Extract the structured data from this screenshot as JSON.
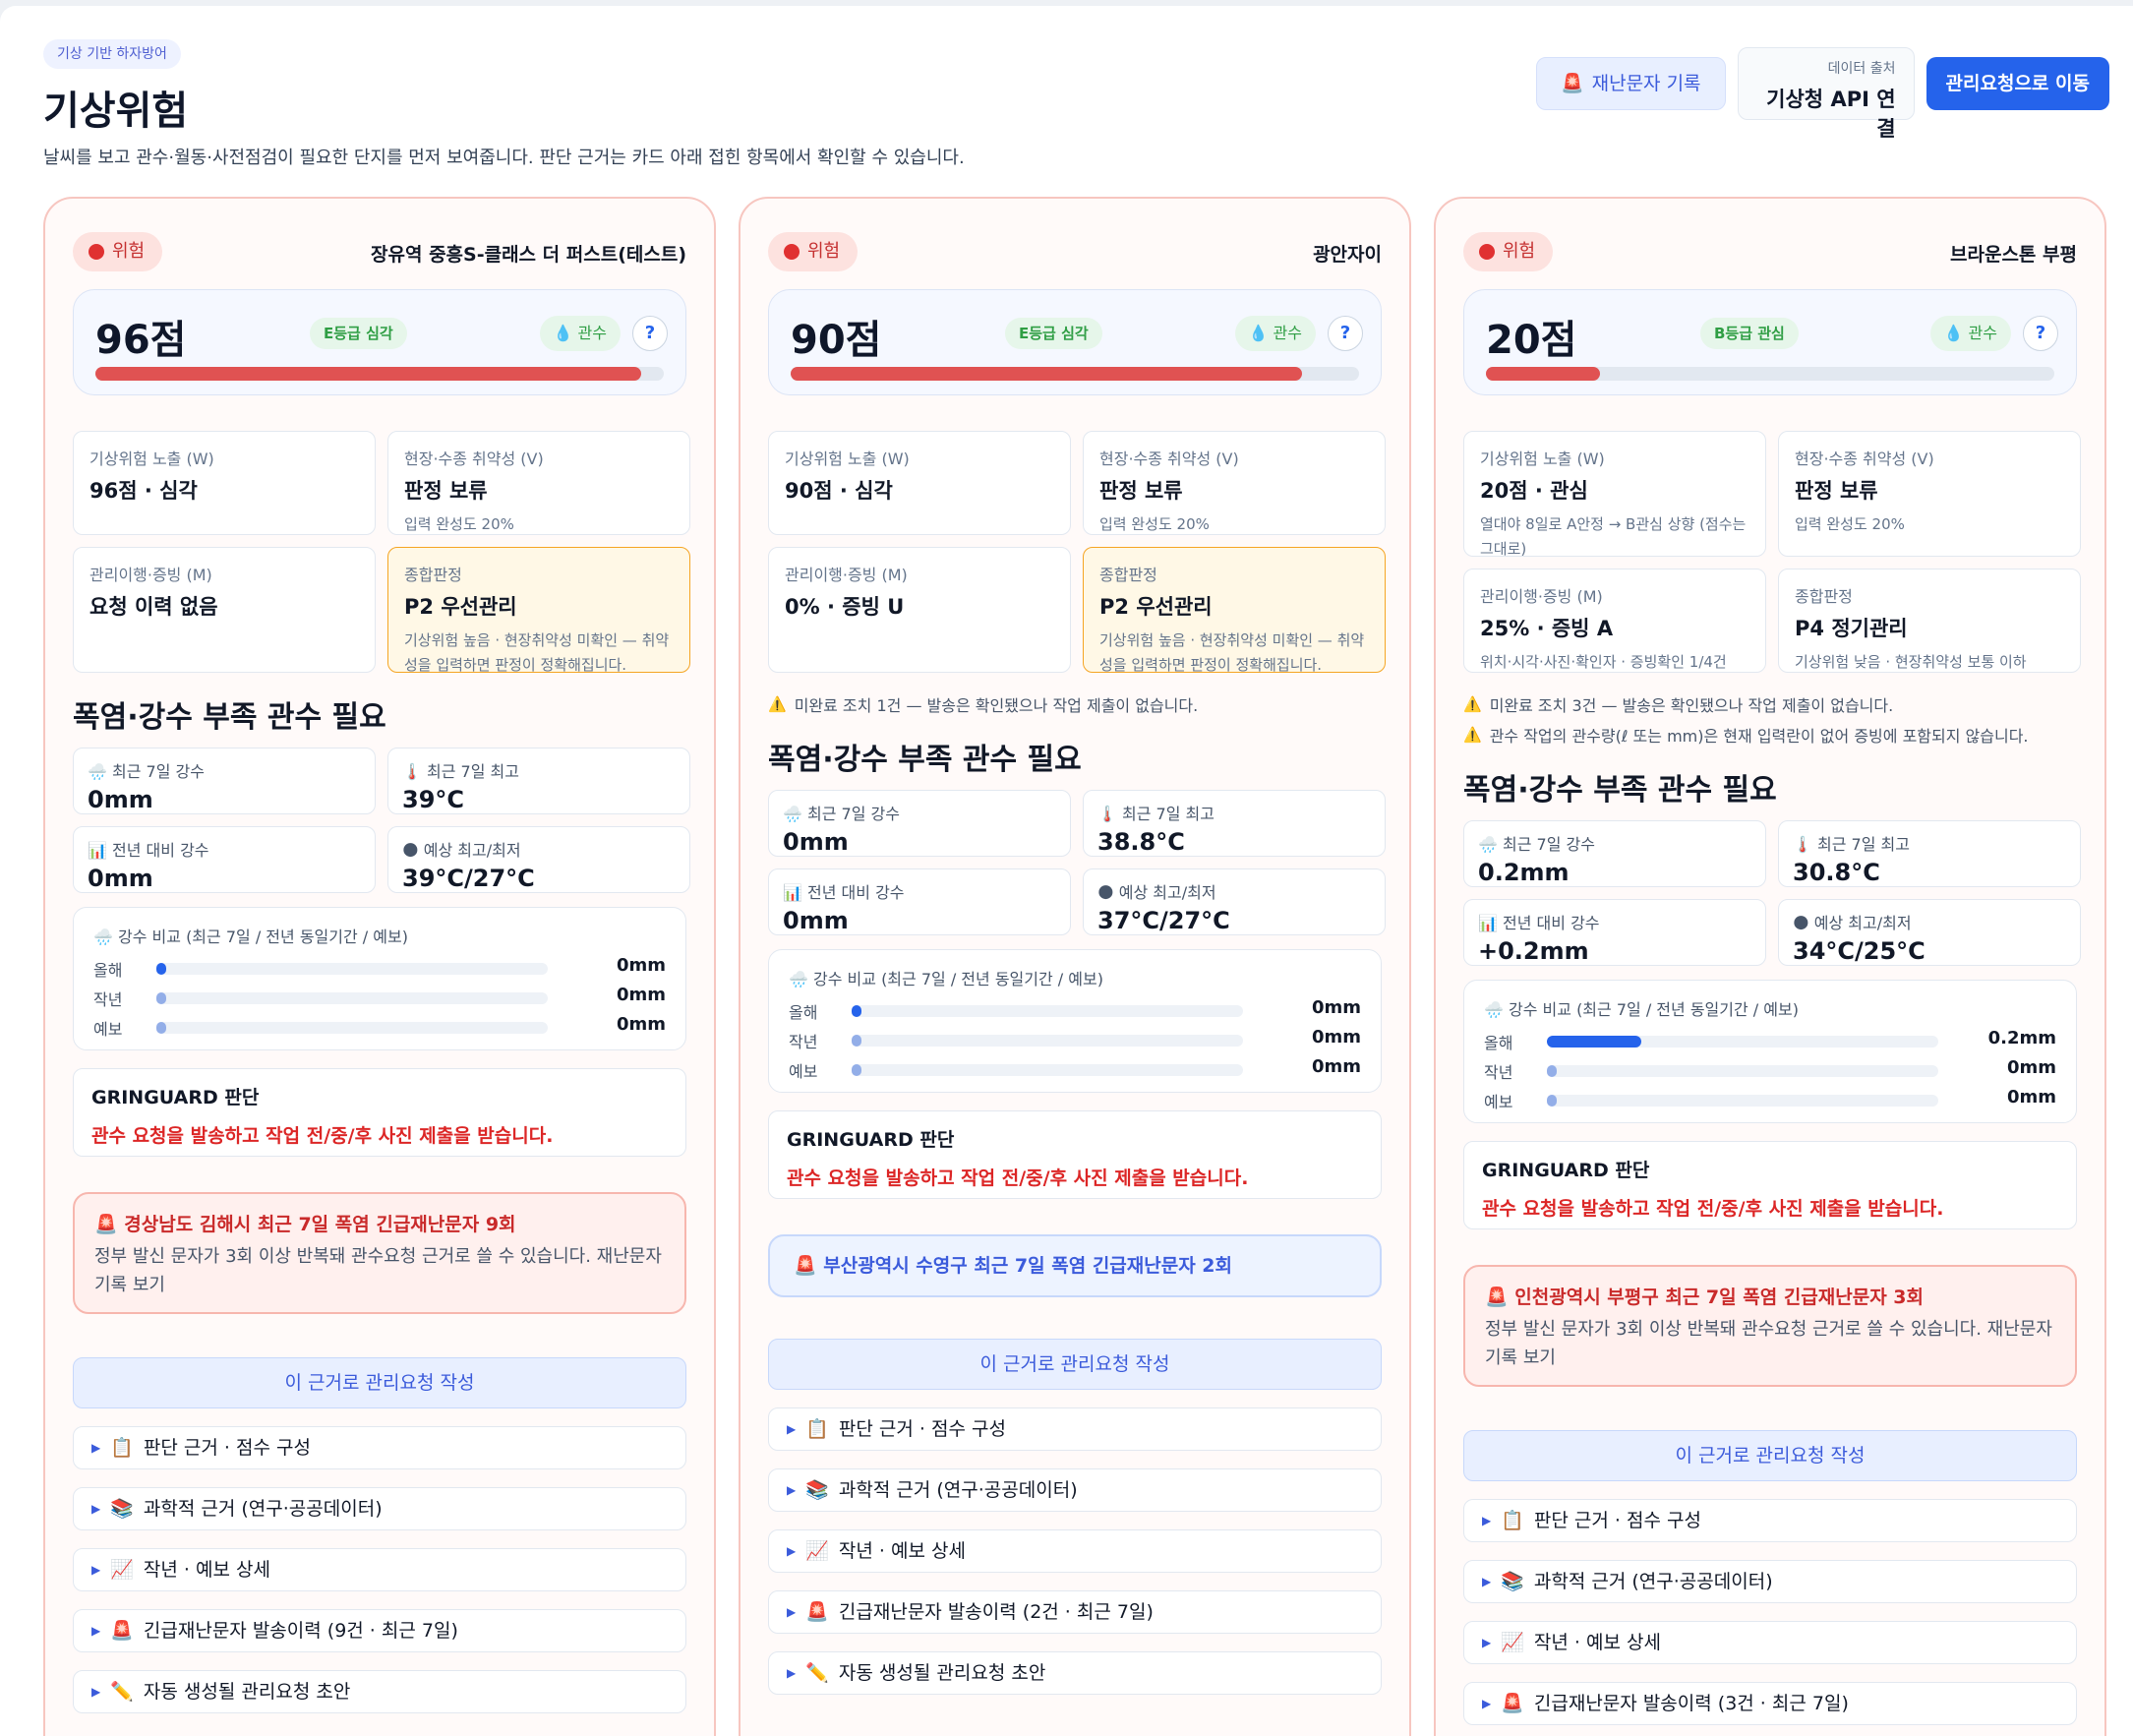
{
  "header": {
    "tag": "기상 기반 하자방어",
    "title": "기상위험",
    "description": "날씨를 보고 관수·월동·사전점검이 필요한 단지를 먼저 보여줍니다. 판단 근거는 카드 아래 접힌 항목에서 확인할 수 있습니다.",
    "disaster_btn": "재난문자 기록",
    "source_label": "데이터 출처",
    "source_value": "기상청 API 연결",
    "move_btn": "관리요청으로 이동"
  },
  "colors": {
    "risk": "#e03131",
    "score_bar": "#e05252",
    "primary": "#2563eb",
    "judgement": "#dc2626",
    "rain_bar": "#2563eb",
    "rain_bar_muted": "#93aee8"
  },
  "cards": [
    {
      "status": "위험",
      "site": "장유역 중흥S-클래스 더 퍼스트(테스트)",
      "score_text": "96점",
      "score_value": 96,
      "grade": "E등급 심각",
      "water_label": "관수",
      "help": "?",
      "metrics": [
        {
          "label": "기상위험 노출 (W)",
          "value": "96점 · 심각",
          "sub": ""
        },
        {
          "label": "현장·수종 취약성 (V)",
          "value": "판정 보류",
          "sub": "입력 완성도 20%"
        },
        {
          "label": "관리이행·증빙 (M)",
          "value": "요청 이력 없음",
          "sub": ""
        },
        {
          "label": "종합판정",
          "value": "P2 우선관리",
          "sub": "기상위험 높음 · 현장취약성 미확인 — 취약성을 입력하면 판정이 정확해집니다."
        }
      ],
      "warnings": [],
      "section_title": "폭염·강수 부족 관수 필요",
      "weather": [
        {
          "label": "최근 7일 강수",
          "value": "0mm"
        },
        {
          "label": "최근 7일 최고",
          "value": "39°C"
        },
        {
          "label": "전년 대비 강수",
          "value": "0mm"
        },
        {
          "label": "예상 최고/최저",
          "value": "39°C/27°C"
        }
      ],
      "compare_title": "강수 비교 (최근 7일 / 전년 동일기간 / 예보)",
      "compare": [
        {
          "name": "올해",
          "value": 0,
          "label": "0mm"
        },
        {
          "name": "작년",
          "value": 0,
          "label": "0mm"
        },
        {
          "name": "예보",
          "value": 0,
          "label": "0mm"
        }
      ],
      "judge_title": "GRINGUARD 판단",
      "judge_message": "관수 요청을 발송하고 작업 전/중/후 사진 제출을 받습니다.",
      "alert_type": "red",
      "alert_title": "경상남도 김해시 최근 7일 폭염 긴급재난문자 9회",
      "alert_desc": "정부 발신 문자가 3회 이상 반복돼 관수요청 근거로 쓸 수 있습니다. 재난문자 기록 보기",
      "request_btn": "이 근거로 관리요청 작성",
      "accordions": [
        {
          "icon": "clipboard",
          "label": "판단 근거 · 점수 구성"
        },
        {
          "icon": "books",
          "label": "과학적 근거 (연구·공공데이터)"
        },
        {
          "icon": "chart",
          "label": "작년 · 예보 상세"
        },
        {
          "icon": "siren",
          "label": "긴급재난문자 발송이력 (9건 · 최근 7일)"
        },
        {
          "icon": "pencil",
          "label": "자동 생성될 관리요청 초안"
        }
      ]
    },
    {
      "status": "위험",
      "site": "광안자이",
      "score_text": "90점",
      "score_value": 90,
      "grade": "E등급 심각",
      "water_label": "관수",
      "help": "?",
      "metrics": [
        {
          "label": "기상위험 노출 (W)",
          "value": "90점 · 심각",
          "sub": ""
        },
        {
          "label": "현장·수종 취약성 (V)",
          "value": "판정 보류",
          "sub": "입력 완성도 20%"
        },
        {
          "label": "관리이행·증빙 (M)",
          "value": "0% · 증빙 U",
          "sub": ""
        },
        {
          "label": "종합판정",
          "value": "P2 우선관리",
          "sub": "기상위험 높음 · 현장취약성 미확인 — 취약성을 입력하면 판정이 정확해집니다."
        }
      ],
      "warnings": [
        "미완료 조치 1건 — 발송은 확인됐으나 작업 제출이 없습니다."
      ],
      "section_title": "폭염·강수 부족 관수 필요",
      "weather": [
        {
          "label": "최근 7일 강수",
          "value": "0mm"
        },
        {
          "label": "최근 7일 최고",
          "value": "38.8°C"
        },
        {
          "label": "전년 대비 강수",
          "value": "0mm"
        },
        {
          "label": "예상 최고/최저",
          "value": "37°C/27°C"
        }
      ],
      "compare_title": "강수 비교 (최근 7일 / 전년 동일기간 / 예보)",
      "compare": [
        {
          "name": "올해",
          "value": 0,
          "label": "0mm"
        },
        {
          "name": "작년",
          "value": 0,
          "label": "0mm"
        },
        {
          "name": "예보",
          "value": 0,
          "label": "0mm"
        }
      ],
      "judge_title": "GRINGUARD 판단",
      "judge_message": "관수 요청을 발송하고 작업 전/중/후 사진 제출을 받습니다.",
      "alert_type": "blue",
      "alert_title": "부산광역시 수영구 최근 7일 폭염 긴급재난문자 2회",
      "alert_desc": "",
      "request_btn": "이 근거로 관리요청 작성",
      "accordions": [
        {
          "icon": "clipboard",
          "label": "판단 근거 · 점수 구성"
        },
        {
          "icon": "books",
          "label": "과학적 근거 (연구·공공데이터)"
        },
        {
          "icon": "chart",
          "label": "작년 · 예보 상세"
        },
        {
          "icon": "siren",
          "label": "긴급재난문자 발송이력 (2건 · 최근 7일)"
        },
        {
          "icon": "pencil",
          "label": "자동 생성될 관리요청 초안"
        }
      ]
    },
    {
      "status": "위험",
      "site": "브라운스톤 부평",
      "score_text": "20점",
      "score_value": 20,
      "grade": "B등급 관심",
      "water_label": "관수",
      "help": "?",
      "metrics": [
        {
          "label": "기상위험 노출 (W)",
          "value": "20점 · 관심",
          "sub": "열대야 8일로 A안정 → B관심 상향 (점수는 그대로)"
        },
        {
          "label": "현장·수종 취약성 (V)",
          "value": "판정 보류",
          "sub": "입력 완성도 20%"
        },
        {
          "label": "관리이행·증빙 (M)",
          "value": "25% · 증빙 A",
          "sub": "위치·시각·사진·확인자 · 증빙확인 1/4건"
        },
        {
          "label": "종합판정",
          "value": "P4 정기관리",
          "sub": "기상위험 낮음 · 현장취약성 보통 이하"
        }
      ],
      "warnings": [
        "미완료 조치 3건 — 발송은 확인됐으나 작업 제출이 없습니다.",
        "관수 작업의 관수량(ℓ 또는 mm)은 현재 입력란이 없어 증빙에 포함되지 않습니다."
      ],
      "section_title": "폭염·강수 부족 관수 필요",
      "weather": [
        {
          "label": "최근 7일 강수",
          "value": "0.2mm"
        },
        {
          "label": "최근 7일 최고",
          "value": "30.8°C"
        },
        {
          "label": "전년 대비 강수",
          "value": "+0.2mm"
        },
        {
          "label": "예상 최고/최저",
          "value": "34°C/25°C"
        }
      ],
      "compare_title": "강수 비교 (최근 7일 / 전년 동일기간 / 예보)",
      "compare": [
        {
          "name": "올해",
          "value": 0.2,
          "label": "0.2mm"
        },
        {
          "name": "작년",
          "value": 0,
          "label": "0mm"
        },
        {
          "name": "예보",
          "value": 0,
          "label": "0mm"
        }
      ],
      "judge_title": "GRINGUARD 판단",
      "judge_message": "관수 요청을 발송하고 작업 전/중/후 사진 제출을 받습니다.",
      "alert_type": "red",
      "alert_title": "인천광역시 부평구 최근 7일 폭염 긴급재난문자 3회",
      "alert_desc": "정부 발신 문자가 3회 이상 반복돼 관수요청 근거로 쓸 수 있습니다. 재난문자 기록 보기",
      "request_btn": "이 근거로 관리요청 작성",
      "accordions": [
        {
          "icon": "clipboard",
          "label": "판단 근거 · 점수 구성"
        },
        {
          "icon": "books",
          "label": "과학적 근거 (연구·공공데이터)"
        },
        {
          "icon": "chart",
          "label": "작년 · 예보 상세"
        },
        {
          "icon": "siren",
          "label": "긴급재난문자 발송이력 (3건 · 최근 7일)"
        }
      ]
    }
  ]
}
